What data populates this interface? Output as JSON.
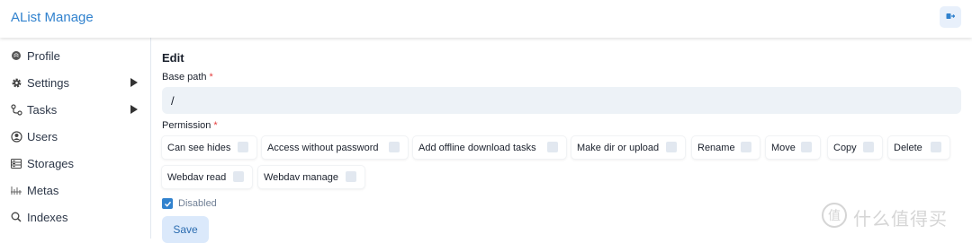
{
  "header": {
    "title": "AList Manage",
    "logout_icon": "logout-icon"
  },
  "sidebar": {
    "items": [
      {
        "label": "Profile",
        "icon": "profile-icon",
        "has_submenu": false
      },
      {
        "label": "Settings",
        "icon": "gear-icon",
        "has_submenu": true
      },
      {
        "label": "Tasks",
        "icon": "tasks-icon",
        "has_submenu": true
      },
      {
        "label": "Users",
        "icon": "user-icon",
        "has_submenu": false
      },
      {
        "label": "Storages",
        "icon": "storage-icon",
        "has_submenu": false
      },
      {
        "label": "Metas",
        "icon": "metas-icon",
        "has_submenu": false
      },
      {
        "label": "Indexes",
        "icon": "search-icon",
        "has_submenu": false
      }
    ]
  },
  "main": {
    "title": "Edit",
    "base_path": {
      "label": "Base path",
      "required_mark": "*",
      "value": "/"
    },
    "permission": {
      "label": "Permission",
      "required_mark": "*",
      "items": [
        {
          "label": "Can see hides",
          "checked": false
        },
        {
          "label": "Access without password",
          "checked": false
        },
        {
          "label": "Add offline download tasks",
          "checked": false
        },
        {
          "label": "Make dir or upload",
          "checked": false
        },
        {
          "label": "Rename",
          "checked": false
        },
        {
          "label": "Move",
          "checked": false
        },
        {
          "label": "Copy",
          "checked": false
        },
        {
          "label": "Delete",
          "checked": false
        },
        {
          "label": "Webdav read",
          "checked": false
        },
        {
          "label": "Webdav manage",
          "checked": false
        }
      ]
    },
    "disabled": {
      "label": "Disabled",
      "checked": true
    },
    "save_label": "Save"
  },
  "watermark": {
    "text": "什么值得买"
  },
  "colors": {
    "accent": "#3182ce",
    "input_bg": "#edf2f7",
    "required": "#e53e3e"
  }
}
